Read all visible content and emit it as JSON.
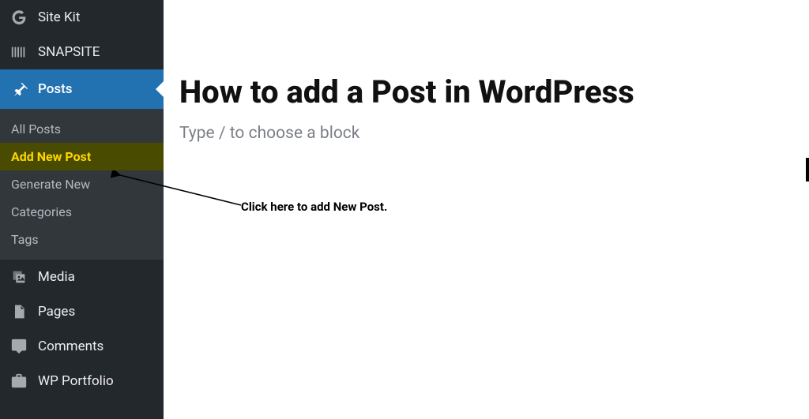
{
  "sidebar": {
    "items": [
      {
        "label": "Site Kit"
      },
      {
        "label": "SNAPSITE"
      },
      {
        "label": "Posts"
      },
      {
        "label": "Media"
      },
      {
        "label": "Pages"
      },
      {
        "label": "Comments"
      },
      {
        "label": "WP Portfolio"
      }
    ],
    "submenu": [
      {
        "label": "All Posts"
      },
      {
        "label": "Add New Post"
      },
      {
        "label": "Generate New"
      },
      {
        "label": "Categories"
      },
      {
        "label": "Tags"
      }
    ]
  },
  "editor": {
    "title": "How to add a Post in WordPress",
    "placeholder": "Type / to choose a block"
  },
  "annotation": {
    "text": "Click here to add New Post."
  }
}
